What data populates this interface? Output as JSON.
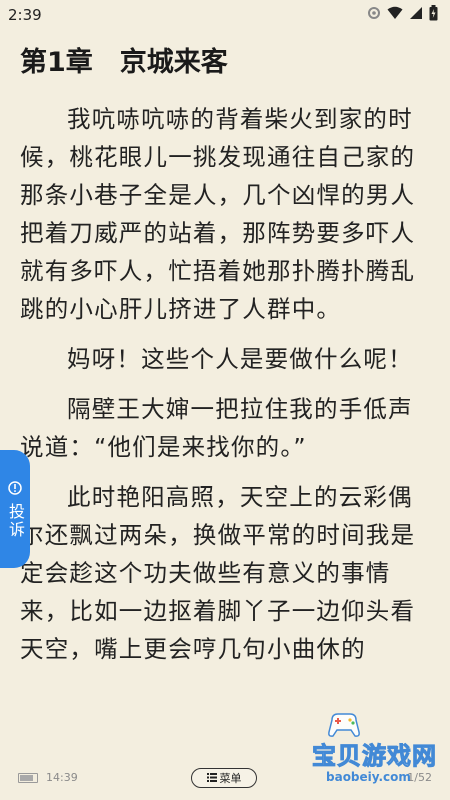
{
  "status_bar": {
    "time": "2:39",
    "icons": [
      "settings-gear-icon",
      "wifi-icon",
      "signal-icon",
      "battery-charging-icon"
    ]
  },
  "chapter": {
    "title": "第1章　京城来客"
  },
  "paragraphs": [
    "我吭哧吭哧的背着柴火到家的时候，桃花眼儿一挑发现通往自己家的那条小巷子全是人，几个凶悍的男人把着刀威严的站着，那阵势要多吓人就有多吓人，忙捂着她那扑腾扑腾乱跳的小心肝儿挤进了人群中。",
    "妈呀！这些个人是要做什么呢！",
    "隔壁王大婶一把拉住我的手低声说道：“他们是来找你的。”",
    "此时艳阳高照，天空上的云彩偶尔还飘过两朵，换做平常的时间我是定会趁这个功夫做些有意义的事情来，比如一边抠着脚丫子一边仰头看天空，嘴上更会哼几句小曲休的"
  ],
  "report_tab": {
    "icon": "info-circle-icon",
    "label": "投诉"
  },
  "bottom_bar": {
    "time": "14:39",
    "menu_label": "菜单",
    "menu_icon": "list-icon",
    "page": "1/52"
  },
  "watermark": {
    "text": "宝贝游戏网",
    "url": "baobeiy.com",
    "icon": "gamepad-icon"
  },
  "colors": {
    "background": "#f3eedf",
    "report_tab": "#2f86e6",
    "watermark_blue": "#2f7fd6"
  }
}
